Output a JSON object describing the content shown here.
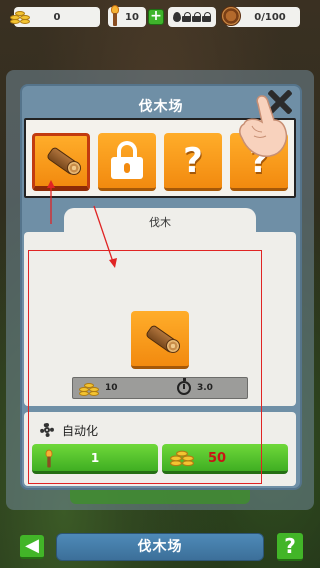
{
  "resources": {
    "coins": "0",
    "torches": "10",
    "plus": "+",
    "barrels": "0/100"
  },
  "modal": {
    "title": "伐木场",
    "tools": [
      {
        "icon": "log-icon",
        "selected": true
      },
      {
        "icon": "lock-icon"
      },
      {
        "icon": "question-icon",
        "label": "?"
      },
      {
        "icon": "question-icon",
        "label": "?"
      }
    ],
    "tab_label": "伐木",
    "item": {
      "icon": "log-icon",
      "cost": "10",
      "time": "3.0"
    },
    "automation": {
      "label": "自动化",
      "torch_cost": "1",
      "coin_cost": "50"
    }
  },
  "bottom": {
    "back": "◀",
    "title": "伐木场",
    "help": "?"
  },
  "colors": {
    "accent_orange": "#f28a0f",
    "green": "#3fae22",
    "annotation_red": "#e02424",
    "modal_blue": "#6f8fa6"
  }
}
